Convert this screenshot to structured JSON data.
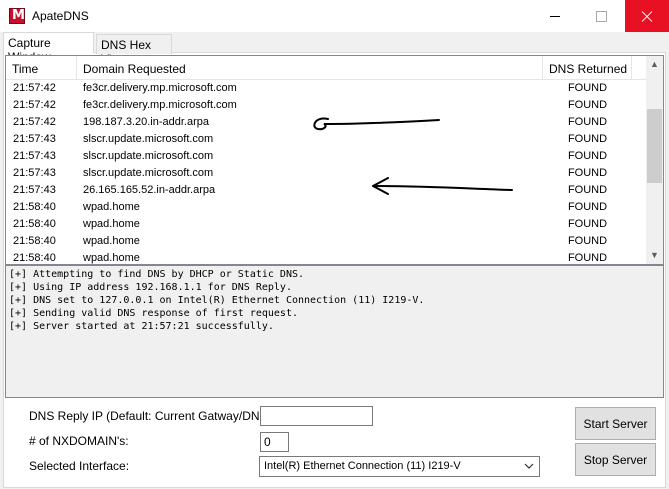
{
  "window": {
    "title": "ApateDNS"
  },
  "tabs": [
    {
      "label": "Capture Window"
    },
    {
      "label": "DNS Hex View"
    }
  ],
  "capture_table": {
    "columns": [
      "Time",
      "Domain Requested",
      "DNS Returned"
    ],
    "rows": [
      {
        "time": "21:57:42",
        "domain": "fe3cr.delivery.mp.microsoft.com",
        "returned": "FOUND"
      },
      {
        "time": "21:57:42",
        "domain": "fe3cr.delivery.mp.microsoft.com",
        "returned": "FOUND"
      },
      {
        "time": "21:57:42",
        "domain": "198.187.3.20.in-addr.arpa",
        "returned": "FOUND"
      },
      {
        "time": "21:57:43",
        "domain": "slscr.update.microsoft.com",
        "returned": "FOUND"
      },
      {
        "time": "21:57:43",
        "domain": "slscr.update.microsoft.com",
        "returned": "FOUND"
      },
      {
        "time": "21:57:43",
        "domain": "slscr.update.microsoft.com",
        "returned": "FOUND"
      },
      {
        "time": "21:57:43",
        "domain": "26.165.165.52.in-addr.arpa",
        "returned": "FOUND"
      },
      {
        "time": "21:58:40",
        "domain": "wpad.home",
        "returned": "FOUND"
      },
      {
        "time": "21:58:40",
        "domain": "wpad.home",
        "returned": "FOUND"
      },
      {
        "time": "21:58:40",
        "domain": "wpad.home",
        "returned": "FOUND"
      },
      {
        "time": "21:58:40",
        "domain": "wpad.home",
        "returned": "FOUND"
      }
    ]
  },
  "log": [
    "[+] Attempting to find DNS by DHCP or Static DNS.",
    "[+] Using IP address 192.168.1.1 for DNS Reply.",
    "[+] DNS set to 127.0.0.1 on Intel(R) Ethernet Connection (11) I219-V.",
    "[+] Sending valid DNS response of first request.",
    "[+] Server started at 21:57:21 successfully."
  ],
  "settings": {
    "reply_ip_label": "DNS Reply IP (Default: Current Gatway/DNS):",
    "reply_ip_value": "",
    "nxdomain_label": "# of NXDOMAIN's:",
    "nxdomain_value": "0",
    "interface_label": "Selected Interface:",
    "interface_value": "Intel(R) Ethernet Connection (11) I219-V"
  },
  "buttons": {
    "start": "Start Server",
    "stop": "Stop Server"
  },
  "icons": {
    "app": "apatedns-app-icon",
    "minimize": "minimize-icon",
    "maximize": "maximize-icon",
    "close": "close-icon",
    "scroll_up": "chevron-up-icon",
    "scroll_down": "chevron-down-icon",
    "dropdown": "chevron-down-icon"
  },
  "colors": {
    "close_button": "#e81123",
    "title_bar": "#ffffff"
  }
}
